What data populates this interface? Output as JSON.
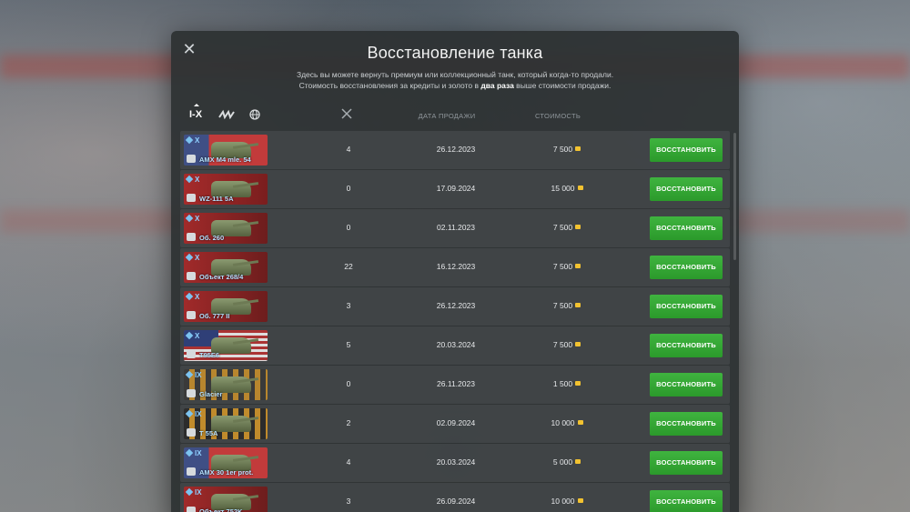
{
  "dialog": {
    "title": "Восстановление танка",
    "subtitle_line1": "Здесь вы можете вернуть премиум или коллекционный танк, который когда-то продали.",
    "subtitle_line2_pre": "Стоимость восстановления за кредиты и золото в ",
    "subtitle_line2_bold": "два раза",
    "subtitle_line2_post": " выше стоимости продажи."
  },
  "filters": {
    "tier_label": "I-X",
    "type_icon": "tank-type-icon",
    "nation_icon": "globe-icon"
  },
  "columns": {
    "battles_icon": "crossed-swords-icon",
    "date": "ДАТА ПРОДАЖИ",
    "cost": "СТОИМОСТЬ"
  },
  "button_label": "ВОССТАНОВИТЬ",
  "tanks": [
    {
      "tier": "X",
      "name": "AMX M4 mle. 54",
      "battles": "4",
      "date": "26.12.2023",
      "cost": "7 500",
      "flag": "fr"
    },
    {
      "tier": "X",
      "name": "WZ-111 5A",
      "battles": "0",
      "date": "17.09.2024",
      "cost": "15 000",
      "flag": "cn"
    },
    {
      "tier": "X",
      "name": "Об. 260",
      "battles": "0",
      "date": "02.11.2023",
      "cost": "7 500",
      "flag": "su"
    },
    {
      "tier": "X",
      "name": "Объект 268/4",
      "battles": "22",
      "date": "16.12.2023",
      "cost": "7 500",
      "flag": "su"
    },
    {
      "tier": "X",
      "name": "Об. 777 II",
      "battles": "3",
      "date": "26.12.2023",
      "cost": "7 500",
      "flag": "su"
    },
    {
      "tier": "X",
      "name": "T95E6",
      "battles": "5",
      "date": "20.03.2024",
      "cost": "7 500",
      "flag": "us"
    },
    {
      "tier": "IX",
      "name": "Glacier",
      "battles": "0",
      "date": "26.11.2023",
      "cost": "1 500",
      "flag": "ribbon"
    },
    {
      "tier": "IX",
      "name": "T 55A",
      "battles": "2",
      "date": "02.09.2024",
      "cost": "10 000",
      "flag": "ribbon2"
    },
    {
      "tier": "IX",
      "name": "AMX 30 1er prot.",
      "battles": "4",
      "date": "20.03.2024",
      "cost": "5 000",
      "flag": "fr"
    },
    {
      "tier": "IX",
      "name": "Объект 752K",
      "battles": "3",
      "date": "26.09.2024",
      "cost": "10 000",
      "flag": "su"
    }
  ]
}
